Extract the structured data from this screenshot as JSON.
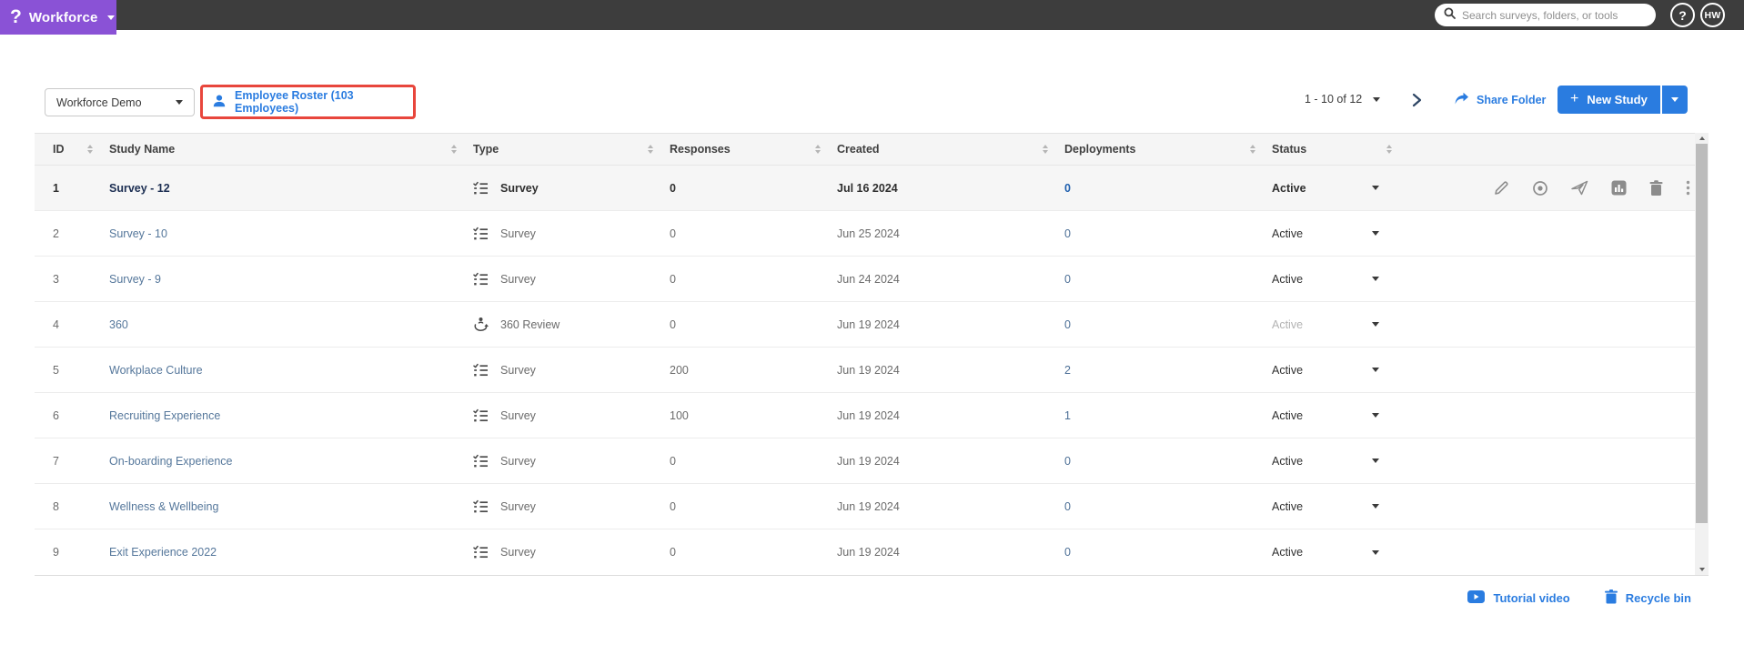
{
  "topbar": {
    "product": "Workforce",
    "logo_glyph": "?",
    "search_placeholder": "Search surveys, folders, or tools",
    "help_label": "?",
    "avatar_initials": "HW"
  },
  "toolbar": {
    "folder_select_value": "Workforce Demo",
    "roster_link_label": "Employee Roster (103 Employees)",
    "pagination_label": "1 - 10 of 12",
    "share_folder_label": "Share Folder",
    "new_study_label": "New Study",
    "new_study_plus": "+"
  },
  "table": {
    "columns": [
      "ID",
      "Study Name",
      "Type",
      "Responses",
      "Created",
      "Deployments",
      "Status"
    ],
    "rows": [
      {
        "id": "1",
        "name": "Survey - 12",
        "type": "Survey",
        "type_icon": "survey-list-icon",
        "responses": "0",
        "created": "Jul 16 2024",
        "deployments": "0",
        "status": "Active",
        "emphasis": true,
        "show_actions": true
      },
      {
        "id": "2",
        "name": "Survey - 10",
        "type": "Survey",
        "type_icon": "survey-list-icon",
        "responses": "0",
        "created": "Jun 25 2024",
        "deployments": "0",
        "status": "Active"
      },
      {
        "id": "3",
        "name": "Survey - 9",
        "type": "Survey",
        "type_icon": "survey-list-icon",
        "responses": "0",
        "created": "Jun 24 2024",
        "deployments": "0",
        "status": "Active"
      },
      {
        "id": "4",
        "name": "360",
        "type": "360 Review",
        "type_icon": "360-review-icon",
        "responses": "0",
        "created": "Jun 19 2024",
        "deployments": "0",
        "status": "Active",
        "status_muted": true
      },
      {
        "id": "5",
        "name": "Workplace Culture",
        "type": "Survey",
        "type_icon": "survey-list-icon",
        "responses": "200",
        "created": "Jun 19 2024",
        "deployments": "2",
        "status": "Active"
      },
      {
        "id": "6",
        "name": "Recruiting Experience",
        "type": "Survey",
        "type_icon": "survey-list-icon",
        "responses": "100",
        "created": "Jun 19 2024",
        "deployments": "1",
        "status": "Active"
      },
      {
        "id": "7",
        "name": "On-boarding Experience",
        "type": "Survey",
        "type_icon": "survey-list-icon",
        "responses": "0",
        "created": "Jun 19 2024",
        "deployments": "0",
        "status": "Active"
      },
      {
        "id": "8",
        "name": "Wellness & Wellbeing",
        "type": "Survey",
        "type_icon": "survey-list-icon",
        "responses": "0",
        "created": "Jun 19 2024",
        "deployments": "0",
        "status": "Active"
      },
      {
        "id": "9",
        "name": "Exit Experience 2022",
        "type": "Survey",
        "type_icon": "survey-list-icon",
        "responses": "0",
        "created": "Jun 19 2024",
        "deployments": "0",
        "status": "Active"
      }
    ],
    "row_action_icons": [
      "edit-pencil-icon",
      "preview-eye-icon",
      "send-icon",
      "reports-chart-icon",
      "delete-trash-icon",
      "more-kebab-icon"
    ]
  },
  "footer": {
    "tutorial_label": "Tutorial video",
    "recycle_label": "Recycle bin"
  },
  "colors": {
    "brand_purple": "#8a52d6",
    "topbar_gray": "#3d3d3d",
    "accent_blue": "#2a7ce0",
    "annotation_red": "#e8463c",
    "emphasis_navy": "#1c2e52",
    "link_steel_blue": "#55779b"
  }
}
